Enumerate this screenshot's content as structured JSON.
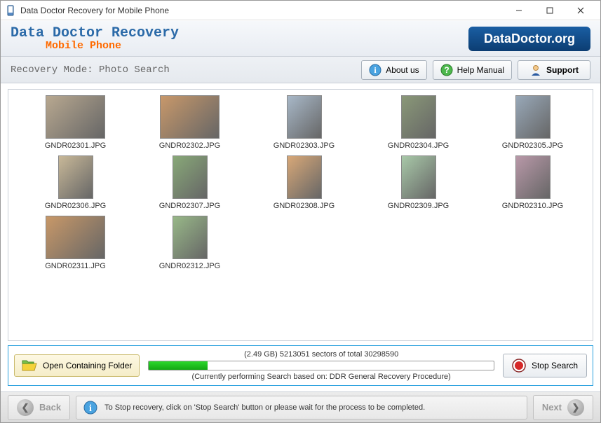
{
  "titlebar": {
    "title": "Data Doctor Recovery for Mobile Phone"
  },
  "brand": {
    "line1": "Data Doctor Recovery",
    "line2": "Mobile Phone",
    "right": "DataDoctor.org"
  },
  "modebar": {
    "label": "Recovery Mode: Photo Search",
    "about": "About us",
    "help": "Help Manual",
    "support": "Support"
  },
  "thumbs": [
    {
      "name": "GNDR02301.JPG",
      "portrait": false
    },
    {
      "name": "GNDR02302.JPG",
      "portrait": false
    },
    {
      "name": "GNDR02303.JPG",
      "portrait": true
    },
    {
      "name": "GNDR02304.JPG",
      "portrait": true
    },
    {
      "name": "GNDR02305.JPG",
      "portrait": true
    },
    {
      "name": "GNDR02306.JPG",
      "portrait": true
    },
    {
      "name": "GNDR02307.JPG",
      "portrait": true
    },
    {
      "name": "GNDR02308.JPG",
      "portrait": true
    },
    {
      "name": "GNDR02309.JPG",
      "portrait": true
    },
    {
      "name": "GNDR02310.JPG",
      "portrait": true
    },
    {
      "name": "GNDR02311.JPG",
      "portrait": false
    },
    {
      "name": "GNDR02312.JPG",
      "portrait": true
    }
  ],
  "progress": {
    "open_folder": "Open Containing Folder",
    "top_text": "(2.49 GB) 5213051  sectors  of  total 30298590",
    "percent": 17,
    "bottom_text": "(Currently performing Search based on:  DDR General Recovery Procedure)",
    "stop": "Stop Search"
  },
  "footer": {
    "back": "Back",
    "next": "Next",
    "message": "To Stop recovery, click on 'Stop Search' button or please wait for the process to be completed."
  }
}
